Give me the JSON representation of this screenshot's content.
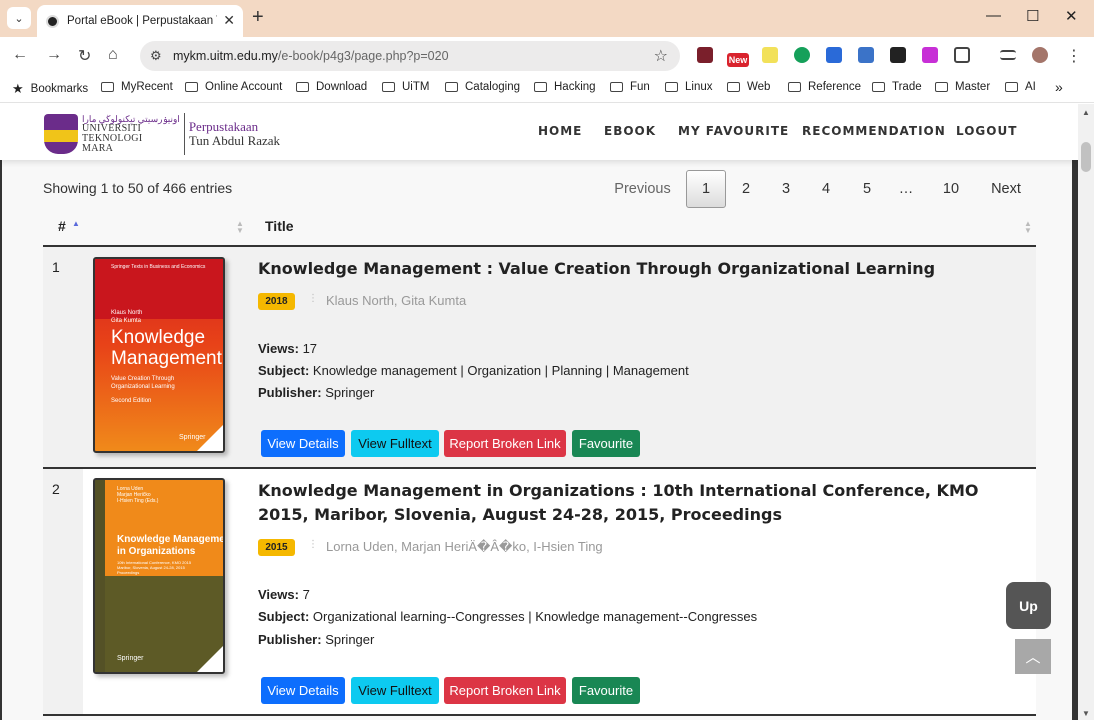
{
  "browser": {
    "tab_title": "Portal eBook | Perpustakaan Tun Abdul Razak",
    "url_host": "mykm.uitm.edu.my",
    "url_path": "/e-book/p4g3/page.php?p=020",
    "bookmarks": [
      "Bookmarks",
      "MyRecent",
      "Online Account",
      "Download",
      "UiTM",
      "Cataloging",
      "Hacking",
      "Fun",
      "Linux",
      "Web",
      "Reference",
      "Trade",
      "Master",
      "AI"
    ],
    "extension_badge": "New"
  },
  "header": {
    "uni_arabic": "اونيۏرسيتي تيكنولوڬي مارا",
    "uni_line1": "UNIVERSITI",
    "uni_line2": "TEKNOLOGI",
    "uni_line3": "MARA",
    "lib_line1": "Perpustakaan",
    "lib_line2": "Tun Abdul Razak",
    "menu": [
      "HOME",
      "EBOOK",
      "MY FAVOURITE",
      "RECOMMENDATION",
      "LOGOUT"
    ]
  },
  "table": {
    "showing": "Showing 1 to 50 of 466 entries",
    "pagination": [
      "Previous",
      "1",
      "2",
      "3",
      "4",
      "5",
      "…",
      "10",
      "Next"
    ],
    "current_page": "1",
    "columns": [
      "#",
      "Title"
    ],
    "rows": [
      {
        "num": "1",
        "title": "Knowledge Management : Value Creation Through Organizational Learning",
        "year": "2018",
        "authors": "Klaus North, Gita Kumta",
        "views_label": "Views:",
        "views": "17",
        "subject_label": "Subject:",
        "subject": "Knowledge management | Organization | Planning | Management",
        "publisher_label": "Publisher:",
        "publisher": "Springer",
        "cover": {
          "series": "Springer Texts in Business and Economics",
          "authors": "Klaus North\nGita Kumta",
          "title": "Knowledge\nManagement",
          "subtitle": "Value Creation Through\nOrganizational Learning",
          "edition": "Second Edition",
          "publisher": "Springer"
        }
      },
      {
        "num": "2",
        "title": "Knowledge Management in Organizations : 10th International Conference, KMO 2015, Maribor, Slovenia, August 24-28, 2015, Proceedings",
        "year": "2015",
        "authors": "Lorna Uden, Marjan HeriÄ�Â�ko, I-Hsien Ting",
        "views_label": "Views:",
        "views": "7",
        "subject_label": "Subject:",
        "subject": "Organizational learning--Congresses | Knowledge management--Congresses",
        "publisher_label": "Publisher:",
        "publisher": "Springer",
        "cover": {
          "authors": "Lorna Uden\nMarjan Heričko\nI-Hsien Ting (Eds.)",
          "title": "Knowledge Management\nin Organizations",
          "subtitle": "10th International Conference, KMO 2015\nMaribor, Slovenia, August 24-28, 2015\nProceedings",
          "publisher": "Springer"
        }
      }
    ],
    "buttons": {
      "details": "View Details",
      "fulltext": "View Fulltext",
      "broken": "Report Broken Link",
      "favourite": "Favourite"
    }
  },
  "floating": {
    "up": "Up",
    "top_icon": "chevron-up-icon"
  },
  "colors": {
    "badge": "#f5b800",
    "btn_blue": "#0d6efd",
    "btn_cyan": "#0dcaf0",
    "btn_red": "#dc3545",
    "btn_green": "#198754",
    "brand_purple": "#6b2c8a"
  }
}
